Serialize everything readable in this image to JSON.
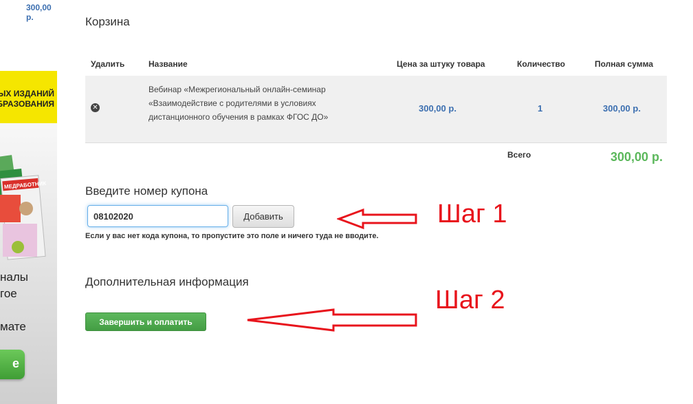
{
  "sidebar": {
    "top_price": "300,00 р.",
    "banner_line1": "НЫХ ИЗДАНИЙ",
    "banner_line2": "ОБРАЗОВАНИЯ",
    "magazine_title": "МЕДРАБОТНИК",
    "text_line1": "налы",
    "text_line2": "гое",
    "text_line3": "мате",
    "green_button_label": "е",
    "colors": {
      "banner": "#f5e600",
      "button": "#4cae4c"
    }
  },
  "cart": {
    "title": "Корзина",
    "columns": {
      "remove": "Удалить",
      "name": "Название",
      "unit_price": "Цена за штуку товара",
      "quantity": "Количество",
      "total": "Полная сумма"
    },
    "items": [
      {
        "name": "Вебинар «Межрегиональный онлайн-семинар «Взаимодействие с родителями в условиях дистанционного обучения в рамках ФГОС ДО»",
        "unit_price": "300,00 р.",
        "quantity": "1",
        "total": "300,00 р."
      }
    ],
    "grand_total_label": "Всего",
    "grand_total": "300,00 р."
  },
  "coupon": {
    "heading": "Введите номер купона",
    "value": "08102020",
    "add_label": "Добавить",
    "note": "Если у вас нет кода купона, то пропустите это поле и ничего туда не вводите."
  },
  "extra": {
    "heading": "Дополнительная информация",
    "finish_label": "Завершить и оплатить"
  },
  "annotations": {
    "step1": "Шаг 1",
    "step2": "Шаг 2",
    "color": "#e8141c"
  }
}
